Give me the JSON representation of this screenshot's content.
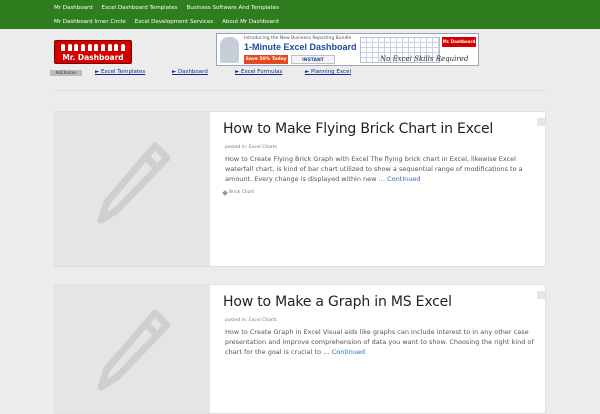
{
  "top_nav": {
    "row1": [
      "Mr Dashboard",
      "Excel Dashboard Templates",
      "Business Software And Templates"
    ],
    "row2": [
      "Mr Dashboard Inner Circle",
      "Excel Development Services",
      "About Mr Dashboard"
    ]
  },
  "logo": {
    "text": "Mr. Dashboard"
  },
  "banner": {
    "intro": "Introducing the New Business Reporting Bundle",
    "headline": "1-Minute Excel Dashboard",
    "save": "Save 50% Today",
    "download": "INSTANT DOWNLOAD",
    "logo_text": "Mr. Dashboard",
    "tagline": "No Excel Skills Required"
  },
  "ad_bar": {
    "adchoices": "AdChoices",
    "links": [
      "► Excel Templates",
      "► Dashboard",
      "► Excel Formulas",
      "► Planning Excel"
    ]
  },
  "posts": [
    {
      "title": "How to Make Flying Brick Chart in Excel",
      "posted_prefix": "posted in:",
      "category": "Excel Charts",
      "excerpt": "How to Create Flying Brick Graph with Excel The flying brick chart in Excel, likewise Excel waterfall chart, is kind of bar chart utilized to show a sequential range of modifications to a amount. Every change is displayed within new …",
      "continue": "Continued",
      "tag": "Brick Chart"
    },
    {
      "title": "How to Make a Graph in MS Excel",
      "posted_prefix": "posted in:",
      "category": "Excel Charts",
      "excerpt": "How to Create Graph in Excel Visual aids like graphs can include interest to in any other case presentation and improve comprehension of data you want to show. Choosing the right kind of chart for the goal is crucial to …",
      "continue": "Continued"
    }
  ],
  "colors": {
    "nav_green": "#2e7d1e",
    "logo_red": "#d40000",
    "link_blue": "#2e6db4"
  }
}
